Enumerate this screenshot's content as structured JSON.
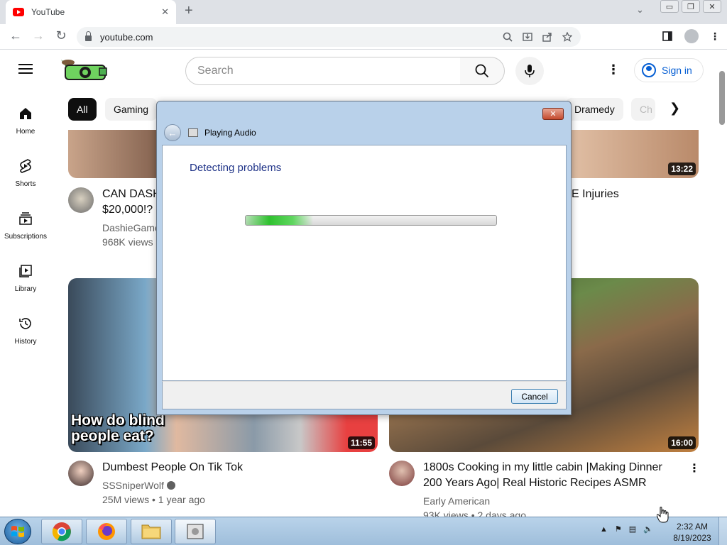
{
  "browser": {
    "tab_title": "YouTube",
    "tab_close": "✕",
    "new_tab": "+",
    "url": "youtube.com",
    "window_buttons": [
      "▭",
      "❐",
      "✕"
    ]
  },
  "youtube": {
    "search_placeholder": "Search",
    "sign_in": "Sign in",
    "chips": [
      "All",
      "Gaming",
      "Dramedy",
      "Ch"
    ],
    "guide": [
      "Home",
      "Shorts",
      "Subscriptions",
      "Library",
      "History"
    ],
    "videos": [
      {
        "title_line1": "CAN DASH",
        "title_line2": "$20,000!? (",
        "channel": "DashieGame",
        "meta": "968K views",
        "duration": ""
      },
      {
        "title_line1": "E Injuries",
        "duration": "13:22"
      },
      {
        "title": "Dumbest People On Tik Tok",
        "channel": "SSSniperWolf",
        "meta": "25M views • 1 year ago",
        "duration": "11:55",
        "thumb_caption": "How do blind people eat?"
      },
      {
        "title_line1": "1800s Cooking in my little cabin |Making Dinner",
        "title_line2": "200 Years Ago| Real Historic Recipes ASMR",
        "channel": "Early American",
        "meta": "93K views • 2 days ago",
        "duration": "16:00"
      }
    ]
  },
  "dialog": {
    "title": "Playing Audio",
    "heading": "Detecting problems",
    "cancel": "Cancel",
    "close": "✕",
    "progress": 0.27
  },
  "taskbar": {
    "time": "2:32 AM",
    "date": "8/19/2023"
  },
  "colors": {
    "youtube_red": "#ff0000",
    "link_blue": "#065fd4",
    "dialog_frame": "#b9d1ea",
    "progress_green": "#2fc12f",
    "taskbar": "#b9d3ea"
  }
}
